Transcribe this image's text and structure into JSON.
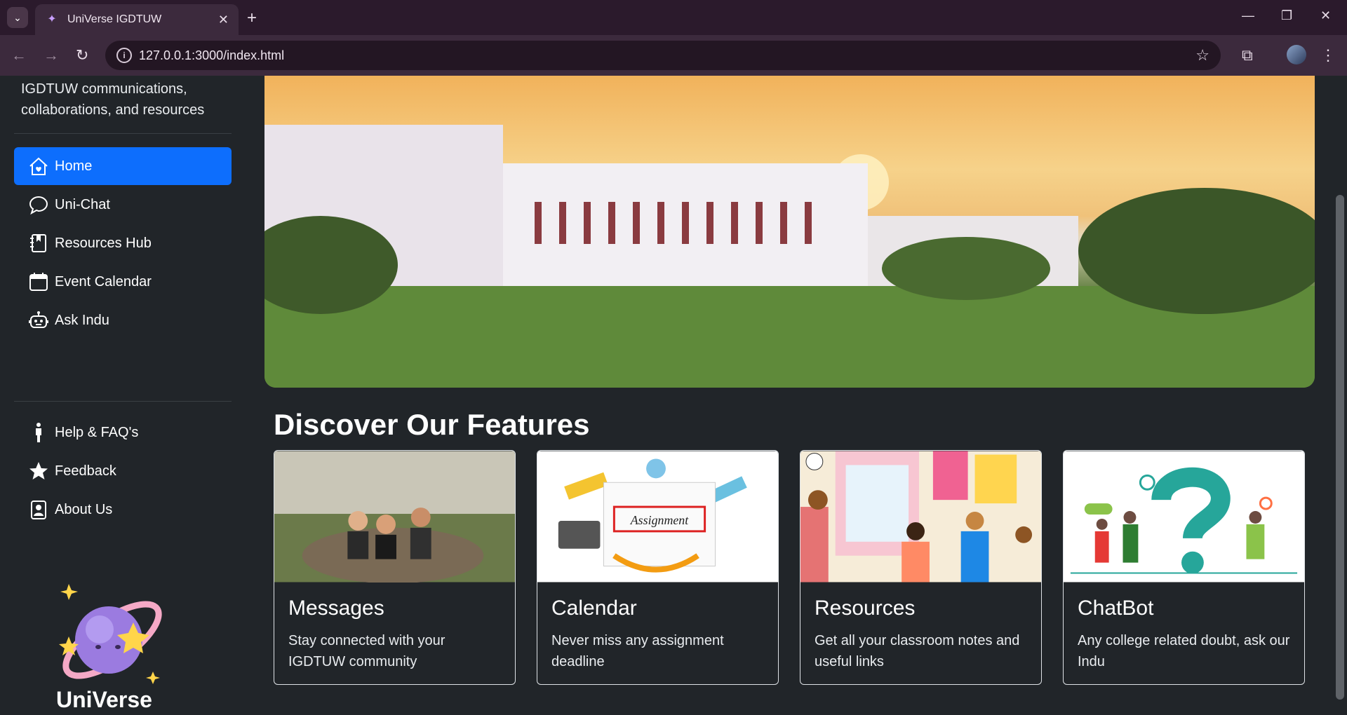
{
  "browser": {
    "tab_title": "UniVerse IGDTUW",
    "url": "127.0.0.1:3000/index.html"
  },
  "sidebar": {
    "description": "IGDTUW communications, collaborations, and resources",
    "nav": [
      {
        "label": "Home",
        "icon": "home-heart-icon",
        "active": true
      },
      {
        "label": "Uni-Chat",
        "icon": "chat-bubble-icon"
      },
      {
        "label": "Resources Hub",
        "icon": "bookmark-book-icon"
      },
      {
        "label": "Event Calendar",
        "icon": "calendar-icon"
      },
      {
        "label": "Ask Indu",
        "icon": "robot-icon"
      }
    ],
    "secondary": [
      {
        "label": "Help & FAQ's",
        "icon": "person-icon"
      },
      {
        "label": "Feedback",
        "icon": "star-icon"
      },
      {
        "label": "About Us",
        "icon": "person-badge-icon"
      }
    ],
    "brand": "UniVerse"
  },
  "main": {
    "section_title": "Discover Our Features",
    "cards": [
      {
        "title": "Messages",
        "text": "Stay connected with your IGDTUW community"
      },
      {
        "title": "Calendar",
        "text": "Never miss any assignment deadline"
      },
      {
        "title": "Resources",
        "text": "Get all your classroom notes and useful links"
      },
      {
        "title": "ChatBot",
        "text": "Any college related doubt, ask our Indu"
      }
    ]
  },
  "colors": {
    "accent": "#0d6efd",
    "background": "#212529",
    "chrome": "#3c2a3d"
  }
}
